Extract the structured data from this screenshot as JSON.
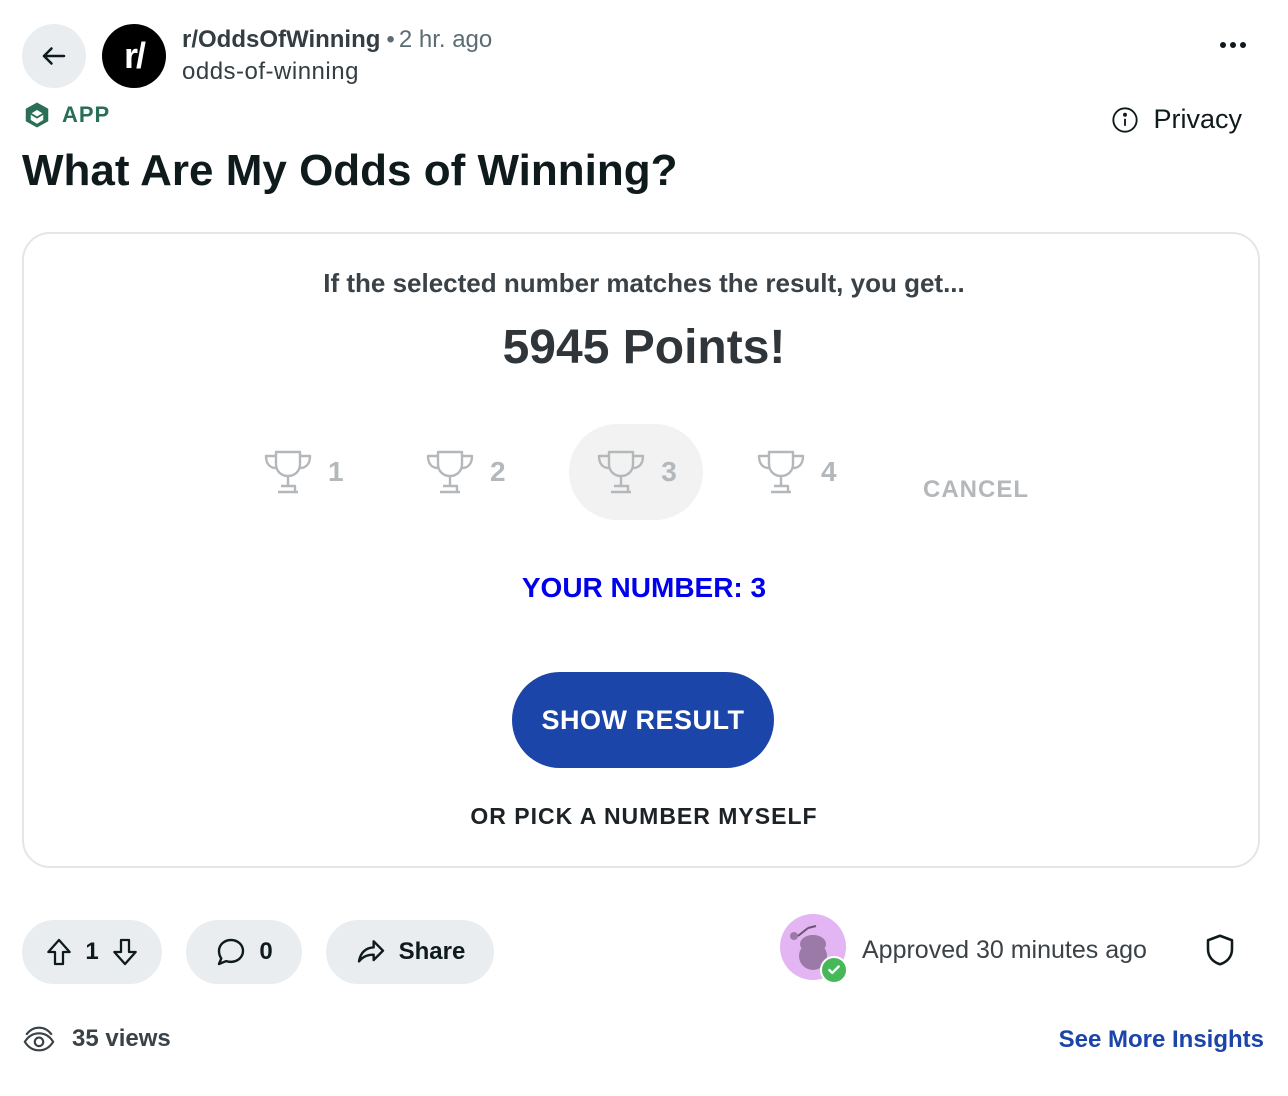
{
  "header": {
    "subreddit": "r/OddsOfWinning",
    "separator": "•",
    "time_ago": "2 hr. ago",
    "username": "odds-of-winning",
    "avatar_text": "r/"
  },
  "badge": {
    "label": "APP"
  },
  "privacy": {
    "label": "Privacy"
  },
  "post": {
    "title": "What Are My Odds of Winning?"
  },
  "game": {
    "intro": "If the selected number matches the result, you get...",
    "points": "5945 Points!",
    "options": [
      "1",
      "2",
      "3",
      "4"
    ],
    "selected_option": "3",
    "cancel": "CANCEL",
    "your_number": "YOUR NUMBER: 3",
    "show_result": "SHOW RESULT",
    "pick_self": "OR PICK A NUMBER MYSELF"
  },
  "actions": {
    "votes": "1",
    "comments": "0",
    "share": "Share"
  },
  "moderation": {
    "approved": "Approved 30 minutes ago"
  },
  "stats": {
    "views": "35 views",
    "insights": "See More Insights"
  },
  "colors": {
    "primary_button": "#1b45a8",
    "your_number": "#0000ee",
    "app_badge": "#2a6f55",
    "approved_check": "#46b85a"
  }
}
